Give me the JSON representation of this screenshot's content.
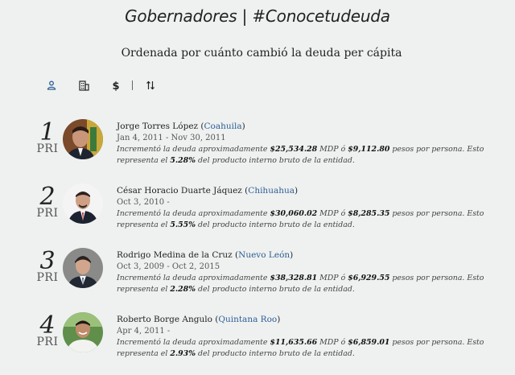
{
  "header": {
    "title": "Gobernadores | #Conocetudeuda",
    "subtitle": "Ordenada por cuánto cambió la deuda per cápita"
  },
  "toolbar": {
    "icons": [
      "person-icon",
      "building-icon",
      "dollar-icon",
      "sort-icon"
    ],
    "active": "person-icon",
    "active_color": "#2e5c98"
  },
  "governors": [
    {
      "rank": "1",
      "party": "PRI",
      "name": "Jorge Torres López",
      "state": "Coahuila",
      "dates": "Jan 4, 2011 - Nov 30, 2011",
      "desc_pre": "Incrementó la deuda aproximadamente ",
      "debt_mdp": "$25,534.28",
      "desc_mid": " MDP ó ",
      "debt_pc": "$9,112.80",
      "desc_post": " pesos por persona. Esto representa el ",
      "pib": "5.28%",
      "desc_end": " del producto interno bruto de la entidad."
    },
    {
      "rank": "2",
      "party": "PRI",
      "name": "César Horacio Duarte Jáquez",
      "state": "Chihuahua",
      "dates": "Oct 3, 2010 -",
      "desc_pre": "Incrementó la deuda aproximadamente ",
      "debt_mdp": "$30,060.02",
      "desc_mid": " MDP ó ",
      "debt_pc": "$8,285.35",
      "desc_post": " pesos por persona. Esto representa el ",
      "pib": "5.55%",
      "desc_end": " del producto interno bruto de la entidad."
    },
    {
      "rank": "3",
      "party": "PRI",
      "name": "Rodrigo Medina de la Cruz",
      "state": "Nuevo León",
      "dates": "Oct 3, 2009 - Oct 2, 2015",
      "desc_pre": "Incrementó la deuda aproximadamente ",
      "debt_mdp": "$38,328.81",
      "desc_mid": " MDP ó ",
      "debt_pc": "$6,929.55",
      "desc_post": " pesos por persona. Esto representa el ",
      "pib": "2.28%",
      "desc_end": " del producto interno bruto de la entidad."
    },
    {
      "rank": "4",
      "party": "PRI",
      "name": "Roberto Borge Angulo",
      "state": "Quintana Roo",
      "dates": "Apr 4, 2011 -",
      "desc_pre": "Incrementó la deuda aproximadamente ",
      "debt_mdp": "$11,635.66",
      "desc_mid": " MDP ó ",
      "debt_pc": "$6,859.01",
      "desc_post": " pesos por persona. Esto representa el ",
      "pib": "2.93%",
      "desc_end": " del producto interno bruto de la entidad."
    }
  ]
}
